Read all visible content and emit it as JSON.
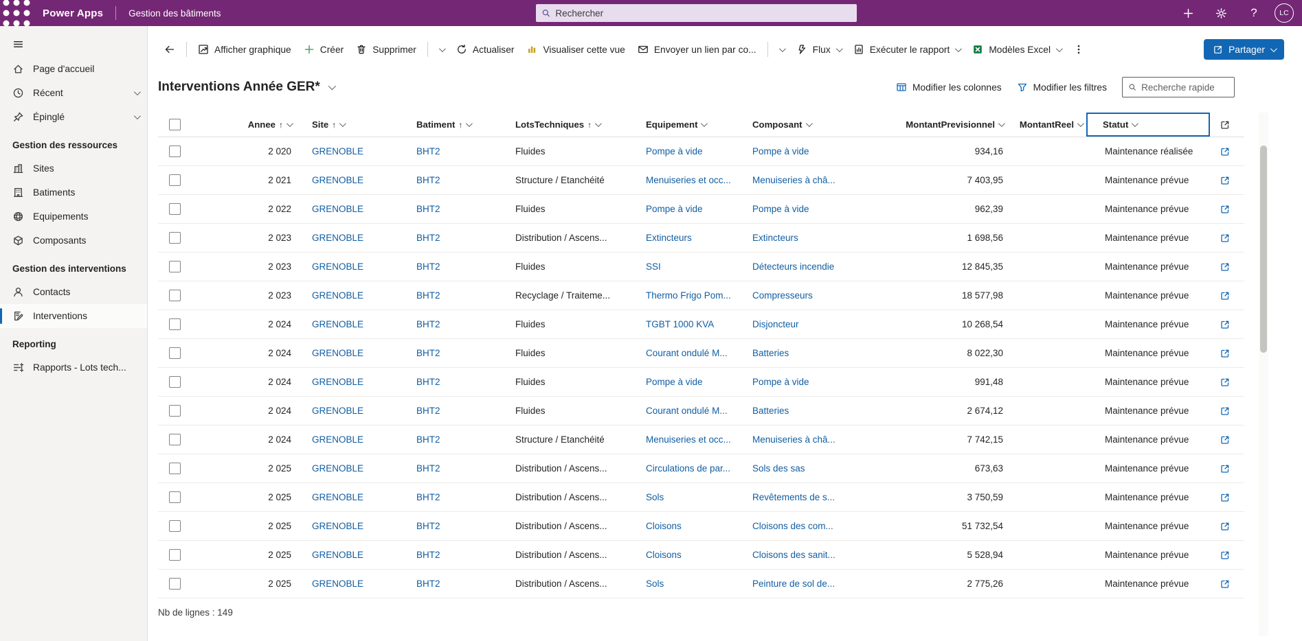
{
  "colors": {
    "topbar": "#742774",
    "accent": "#1267b4",
    "link": "#115ea3",
    "excel_green": "#107c41",
    "create_green": "#4fa264",
    "visualize_gold": "#c9a227"
  },
  "topbar": {
    "brand": "Power Apps",
    "app_name": "Gestion des bâtiments",
    "search_placeholder": "Rechercher",
    "avatar_initials": "LC"
  },
  "command_bar": {
    "items": [
      {
        "type": "button",
        "name": "back-button",
        "icon": "back"
      },
      {
        "type": "divider"
      },
      {
        "type": "button",
        "name": "show-chart-button",
        "icon": "chart",
        "label": "Afficher graphique"
      },
      {
        "type": "button",
        "name": "create-button",
        "icon": "plus",
        "icon_class": "icon-create",
        "label": "Créer"
      },
      {
        "type": "button",
        "name": "delete-button",
        "icon": "trash",
        "label": "Supprimer"
      },
      {
        "type": "divider"
      },
      {
        "type": "button",
        "name": "delete-overflow-button",
        "chevron": true
      },
      {
        "type": "button",
        "name": "refresh-button",
        "icon": "refresh",
        "label": "Actualiser"
      },
      {
        "type": "button",
        "name": "visualize-view-button",
        "icon": "visualize",
        "icon_class": "icon-gold",
        "label": "Visualiser cette vue"
      },
      {
        "type": "button",
        "name": "email-link-button",
        "icon": "email",
        "label": "Envoyer un lien par co..."
      },
      {
        "type": "divider"
      },
      {
        "type": "button",
        "name": "email-overflow-button",
        "chevron": true
      },
      {
        "type": "button",
        "name": "flow-button",
        "icon": "flow",
        "label": "Flux",
        "chevron": true
      },
      {
        "type": "button",
        "name": "run-report-button",
        "icon": "report",
        "label": "Exécuter le rapport",
        "chevron": true
      },
      {
        "type": "button",
        "name": "excel-templates-button",
        "icon": "excel",
        "icon_class": "icon-excel",
        "label": "Modèles Excel",
        "chevron": true
      },
      {
        "type": "button",
        "name": "more-commands-button",
        "icon": "ellipsis"
      }
    ],
    "share_label": "Partager"
  },
  "sidebar": {
    "top_items": [
      {
        "icon": "home",
        "label": "Page d'accueil"
      },
      {
        "icon": "clock",
        "label": "Récent",
        "chevron": true
      },
      {
        "icon": "pin",
        "label": "Épinglé",
        "chevron": true
      }
    ],
    "groups": [
      {
        "label": "Gestion des ressources",
        "items": [
          {
            "icon": "sites",
            "label": "Sites"
          },
          {
            "icon": "building",
            "label": "Batiments"
          },
          {
            "icon": "equipment",
            "label": "Equipements"
          },
          {
            "icon": "component",
            "label": "Composants"
          }
        ]
      },
      {
        "label": "Gestion des interventions",
        "items": [
          {
            "icon": "person",
            "label": "Contacts"
          },
          {
            "icon": "intervention",
            "label": "Interventions",
            "active": true
          }
        ]
      },
      {
        "label": "Reporting",
        "items": [
          {
            "icon": "report-list",
            "label": "Rapports - Lots tech..."
          }
        ]
      }
    ]
  },
  "view_header": {
    "title": "Interventions Année GER*",
    "edit_columns_label": "Modifier les colonnes",
    "edit_filters_label": "Modifier les filtres",
    "quick_search_placeholder": "Recherche rapide"
  },
  "table": {
    "columns": [
      {
        "key": "annee",
        "label": "Annee",
        "sorted": true,
        "align": "right"
      },
      {
        "key": "site",
        "label": "Site",
        "sorted": true
      },
      {
        "key": "batiment",
        "label": "Batiment",
        "sorted": true
      },
      {
        "key": "lots",
        "label": "LotsTechniques",
        "sorted": true
      },
      {
        "key": "equipement",
        "label": "Equipement"
      },
      {
        "key": "composant",
        "label": "Composant"
      },
      {
        "key": "montant_previsionnel",
        "label": "MontantPrevisionnel",
        "align": "right"
      },
      {
        "key": "montant_reel",
        "label": "MontantReel",
        "align": "right"
      },
      {
        "key": "statut",
        "label": "Statut",
        "focused": true
      }
    ],
    "rows": [
      [
        "2 020",
        "GRENOBLE",
        "BHT2",
        "Fluides",
        "Pompe à vide",
        "Pompe à vide",
        "934,16",
        "",
        "Maintenance réalisée"
      ],
      [
        "2 021",
        "GRENOBLE",
        "BHT2",
        "Structure / Etanchéité",
        "Menuiseries et occ...",
        "Menuiseries à châ...",
        "7 403,95",
        "",
        "Maintenance prévue"
      ],
      [
        "2 022",
        "GRENOBLE",
        "BHT2",
        "Fluides",
        "Pompe à vide",
        "Pompe à vide",
        "962,39",
        "",
        "Maintenance prévue"
      ],
      [
        "2 023",
        "GRENOBLE",
        "BHT2",
        "Distribution / Ascens...",
        "Extincteurs",
        "Extincteurs",
        "1 698,56",
        "",
        "Maintenance prévue"
      ],
      [
        "2 023",
        "GRENOBLE",
        "BHT2",
        "Fluides",
        "SSI",
        "Détecteurs incendie",
        "12 845,35",
        "",
        "Maintenance prévue"
      ],
      [
        "2 023",
        "GRENOBLE",
        "BHT2",
        "Recyclage / Traiteme...",
        "Thermo Frigo Pom...",
        "Compresseurs",
        "18 577,98",
        "",
        "Maintenance prévue"
      ],
      [
        "2 024",
        "GRENOBLE",
        "BHT2",
        "Fluides",
        "TGBT 1000 KVA",
        "Disjoncteur",
        "10 268,54",
        "",
        "Maintenance prévue"
      ],
      [
        "2 024",
        "GRENOBLE",
        "BHT2",
        "Fluides",
        "Courant ondulé M...",
        "Batteries",
        "8 022,30",
        "",
        "Maintenance prévue"
      ],
      [
        "2 024",
        "GRENOBLE",
        "BHT2",
        "Fluides",
        "Pompe à vide",
        "Pompe à vide",
        "991,48",
        "",
        "Maintenance prévue"
      ],
      [
        "2 024",
        "GRENOBLE",
        "BHT2",
        "Fluides",
        "Courant ondulé M...",
        "Batteries",
        "2 674,12",
        "",
        "Maintenance prévue"
      ],
      [
        "2 024",
        "GRENOBLE",
        "BHT2",
        "Structure / Etanchéité",
        "Menuiseries et occ...",
        "Menuiseries à châ...",
        "7 742,15",
        "",
        "Maintenance prévue"
      ],
      [
        "2 025",
        "GRENOBLE",
        "BHT2",
        "Distribution / Ascens...",
        "Circulations de par...",
        "Sols des sas",
        "673,63",
        "",
        "Maintenance prévue"
      ],
      [
        "2 025",
        "GRENOBLE",
        "BHT2",
        "Distribution / Ascens...",
        "Sols",
        "Revêtements de s...",
        "3 750,59",
        "",
        "Maintenance prévue"
      ],
      [
        "2 025",
        "GRENOBLE",
        "BHT2",
        "Distribution / Ascens...",
        "Cloisons",
        "Cloisons des com...",
        "51 732,54",
        "",
        "Maintenance prévue"
      ],
      [
        "2 025",
        "GRENOBLE",
        "BHT2",
        "Distribution / Ascens...",
        "Cloisons",
        "Cloisons des sanit...",
        "5 528,94",
        "",
        "Maintenance prévue"
      ],
      [
        "2 025",
        "GRENOBLE",
        "BHT2",
        "Distribution / Ascens...",
        "Sols",
        "Peinture de sol de...",
        "2 775,26",
        "",
        "Maintenance prévue"
      ]
    ]
  },
  "footer": {
    "row_count": "Nb de lignes : 149"
  }
}
